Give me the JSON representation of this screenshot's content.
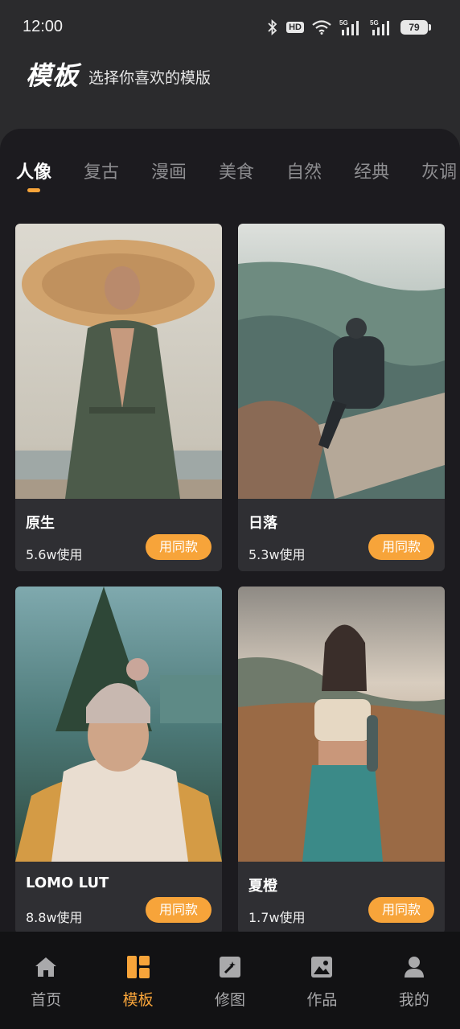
{
  "status_bar": {
    "time": "12:00",
    "icons": [
      "bluetooth-icon",
      "hd-icon",
      "wifi-icon",
      "signal-5g-icon",
      "signal-5g-icon"
    ],
    "hd_label": "HD",
    "battery_level": "79"
  },
  "header": {
    "title": "模板",
    "subtitle": "选择你喜欢的模版"
  },
  "tabs": [
    {
      "label": "人像",
      "active": true
    },
    {
      "label": "复古",
      "active": false
    },
    {
      "label": "漫画",
      "active": false
    },
    {
      "label": "美食",
      "active": false
    },
    {
      "label": "自然",
      "active": false
    },
    {
      "label": "经典",
      "active": false
    },
    {
      "label": "灰调",
      "active": false
    }
  ],
  "colors": {
    "accent": "#f7a43a",
    "background": "#2b2b2d",
    "panel": "#1c1b1f",
    "card": "#2f2f33",
    "nav": "#121214"
  },
  "templates": [
    {
      "name": "原生",
      "usage": "5.6w使用",
      "button": "用同款"
    },
    {
      "name": "日落",
      "usage": "5.3w使用",
      "button": "用同款"
    },
    {
      "name": "LOMO LUT",
      "usage": "8.8w使用",
      "button": "用同款"
    },
    {
      "name": "夏橙",
      "usage": "1.7w使用",
      "button": "用同款"
    }
  ],
  "bottom_nav": [
    {
      "label": "首页",
      "icon": "home-icon",
      "active": false
    },
    {
      "label": "模板",
      "icon": "template-icon",
      "active": true
    },
    {
      "label": "修图",
      "icon": "edit-photo-icon",
      "active": false
    },
    {
      "label": "作品",
      "icon": "gallery-icon",
      "active": false
    },
    {
      "label": "我的",
      "icon": "profile-icon",
      "active": false
    }
  ]
}
